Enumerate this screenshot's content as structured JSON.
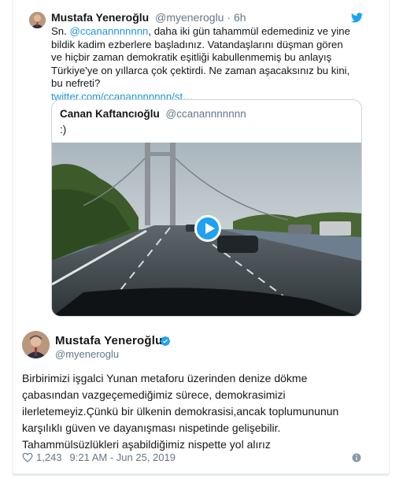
{
  "top_tweet": {
    "author_name": "Mustafa Yeneroğlu",
    "author_handle": "@myeneroglu",
    "separator": " · ",
    "time": "6h",
    "text_prefix": "Sn. ",
    "mention": "@ccanannnnnnn",
    "text_body": ", daha iki gün tahammül edemediniz ve yine  bildik kadim ezberlere başladınız. Vatandaşlarını düşman gören ve hiçbir zaman demokratik eşitliği kabullenmemiş bu anlayış Türkiye'ye on yıllarca çok çektirdi. Ne zaman aşacaksınız bu kini, bu nefreti?",
    "link": "twitter.com/ccanannnnnnn/st…"
  },
  "quoted_tweet": {
    "author_name": "Canan Kaftancıoğlu",
    "author_handle": "@ccanannnnnnn",
    "text": ":)"
  },
  "main_tweet": {
    "author_name": "Mustafa Yeneroğlu",
    "author_handle": "@myeneroglu",
    "lines": [
      "Birbirimizi işgalci Yunan metaforu üzerinden denize dökme",
      "çabasından vazgeçemediğimiz sürece, demokrasimizi",
      "ilerletemeyiz.Çünkü bir ülkenin demokrasisi,ancak  toplumununun",
      "karşılıklı güven ve dayanışması nispetinde gelişebilir.",
      "Tahammülsüzlükleri aşabildiğimiz nispette yol alırız"
    ],
    "likes": "1,243",
    "timestamp": "9:21 AM - Jun 25, 2019"
  },
  "colors": {
    "link": "#1b95e0",
    "twitter_blue": "#1da1f2",
    "muted": "#657786",
    "border": "#ccd6dd"
  },
  "icons": [
    "twitter-bird-icon",
    "verified-icon",
    "heart-icon",
    "info-icon",
    "play-icon"
  ]
}
